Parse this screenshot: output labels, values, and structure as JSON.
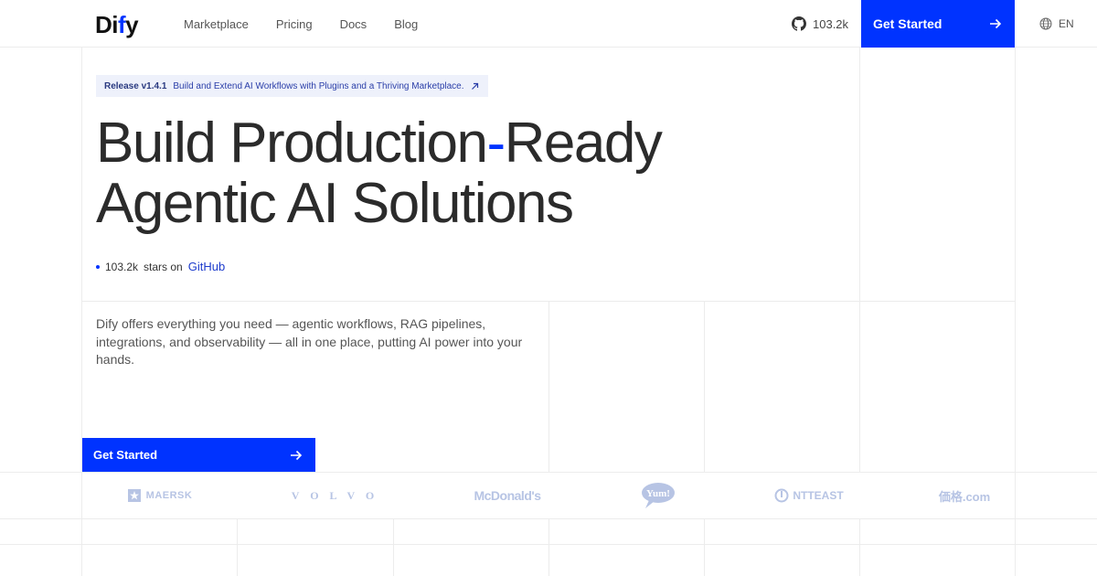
{
  "header": {
    "logo_pre": "Di",
    "logo_accent": "f",
    "logo_post": "y",
    "nav": [
      "Marketplace",
      "Pricing",
      "Docs",
      "Blog"
    ],
    "github_stars": "103.2k",
    "cta_label": "Get Started",
    "lang": "EN"
  },
  "release": {
    "version": "Release v1.4.1",
    "text": "Build and Extend AI Workflows with Plugins and a Thriving Marketplace."
  },
  "hero": {
    "line1_a": "Build Production",
    "line1_dash": "-",
    "line1_b": "Ready",
    "line2": "Agentic AI Solutions",
    "stars_count": "103.2k",
    "stars_text": "stars on",
    "stars_link": "GitHub",
    "description": "Dify offers everything you need — agentic workflows, RAG pipelines, integrations, and observability — all in one place, putting AI power into your hands.",
    "cta_label": "Get Started"
  },
  "logos": [
    "MAERSK",
    "VOLVO",
    "McDonald's",
    "Yum!",
    "NTTEAST",
    "価格.com"
  ],
  "colors": {
    "accent": "#0033ff",
    "logo_tint": "#b7c4e4"
  }
}
